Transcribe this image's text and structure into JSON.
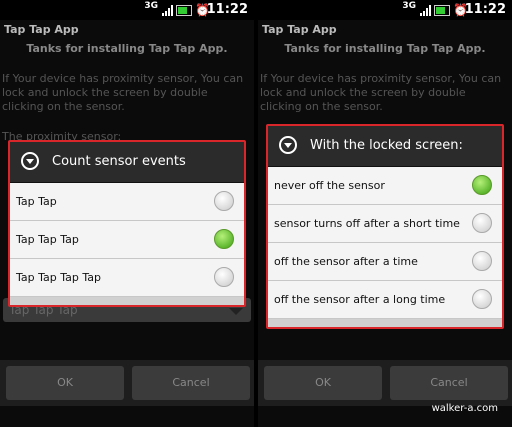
{
  "status": {
    "network": "3G",
    "time": "11:22"
  },
  "app_title": "Tap Tap App",
  "thanks": "Tanks for installing Tap Tap App.",
  "info": "If Your device has proximity sensor, You can lock and unlock the screen by double clicking on the sensor.",
  "proximity_label": "The proximity sensor:",
  "left_dialog": {
    "title": "Count sensor events",
    "options": [
      {
        "label": "Tap Tap",
        "selected": false
      },
      {
        "label": "Tap Tap Tap",
        "selected": true
      },
      {
        "label": "Tap Tap Tap Tap",
        "selected": false
      }
    ]
  },
  "right_dialog": {
    "title": "With the locked screen:",
    "options": [
      {
        "label": "never off the sensor",
        "selected": true
      },
      {
        "label": "sensor turns off after a short time",
        "selected": false
      },
      {
        "label": "off the sensor after a time",
        "selected": false
      },
      {
        "label": "off the sensor after a long time",
        "selected": false
      }
    ]
  },
  "bg_spinner_value": "Tap Tap Tap",
  "buttons": {
    "ok": "OK",
    "cancel": "Cancel"
  },
  "credit": "walker-a.com",
  "colors": {
    "selected_radio": "#3aa010",
    "highlight_border": "#d8262b"
  }
}
